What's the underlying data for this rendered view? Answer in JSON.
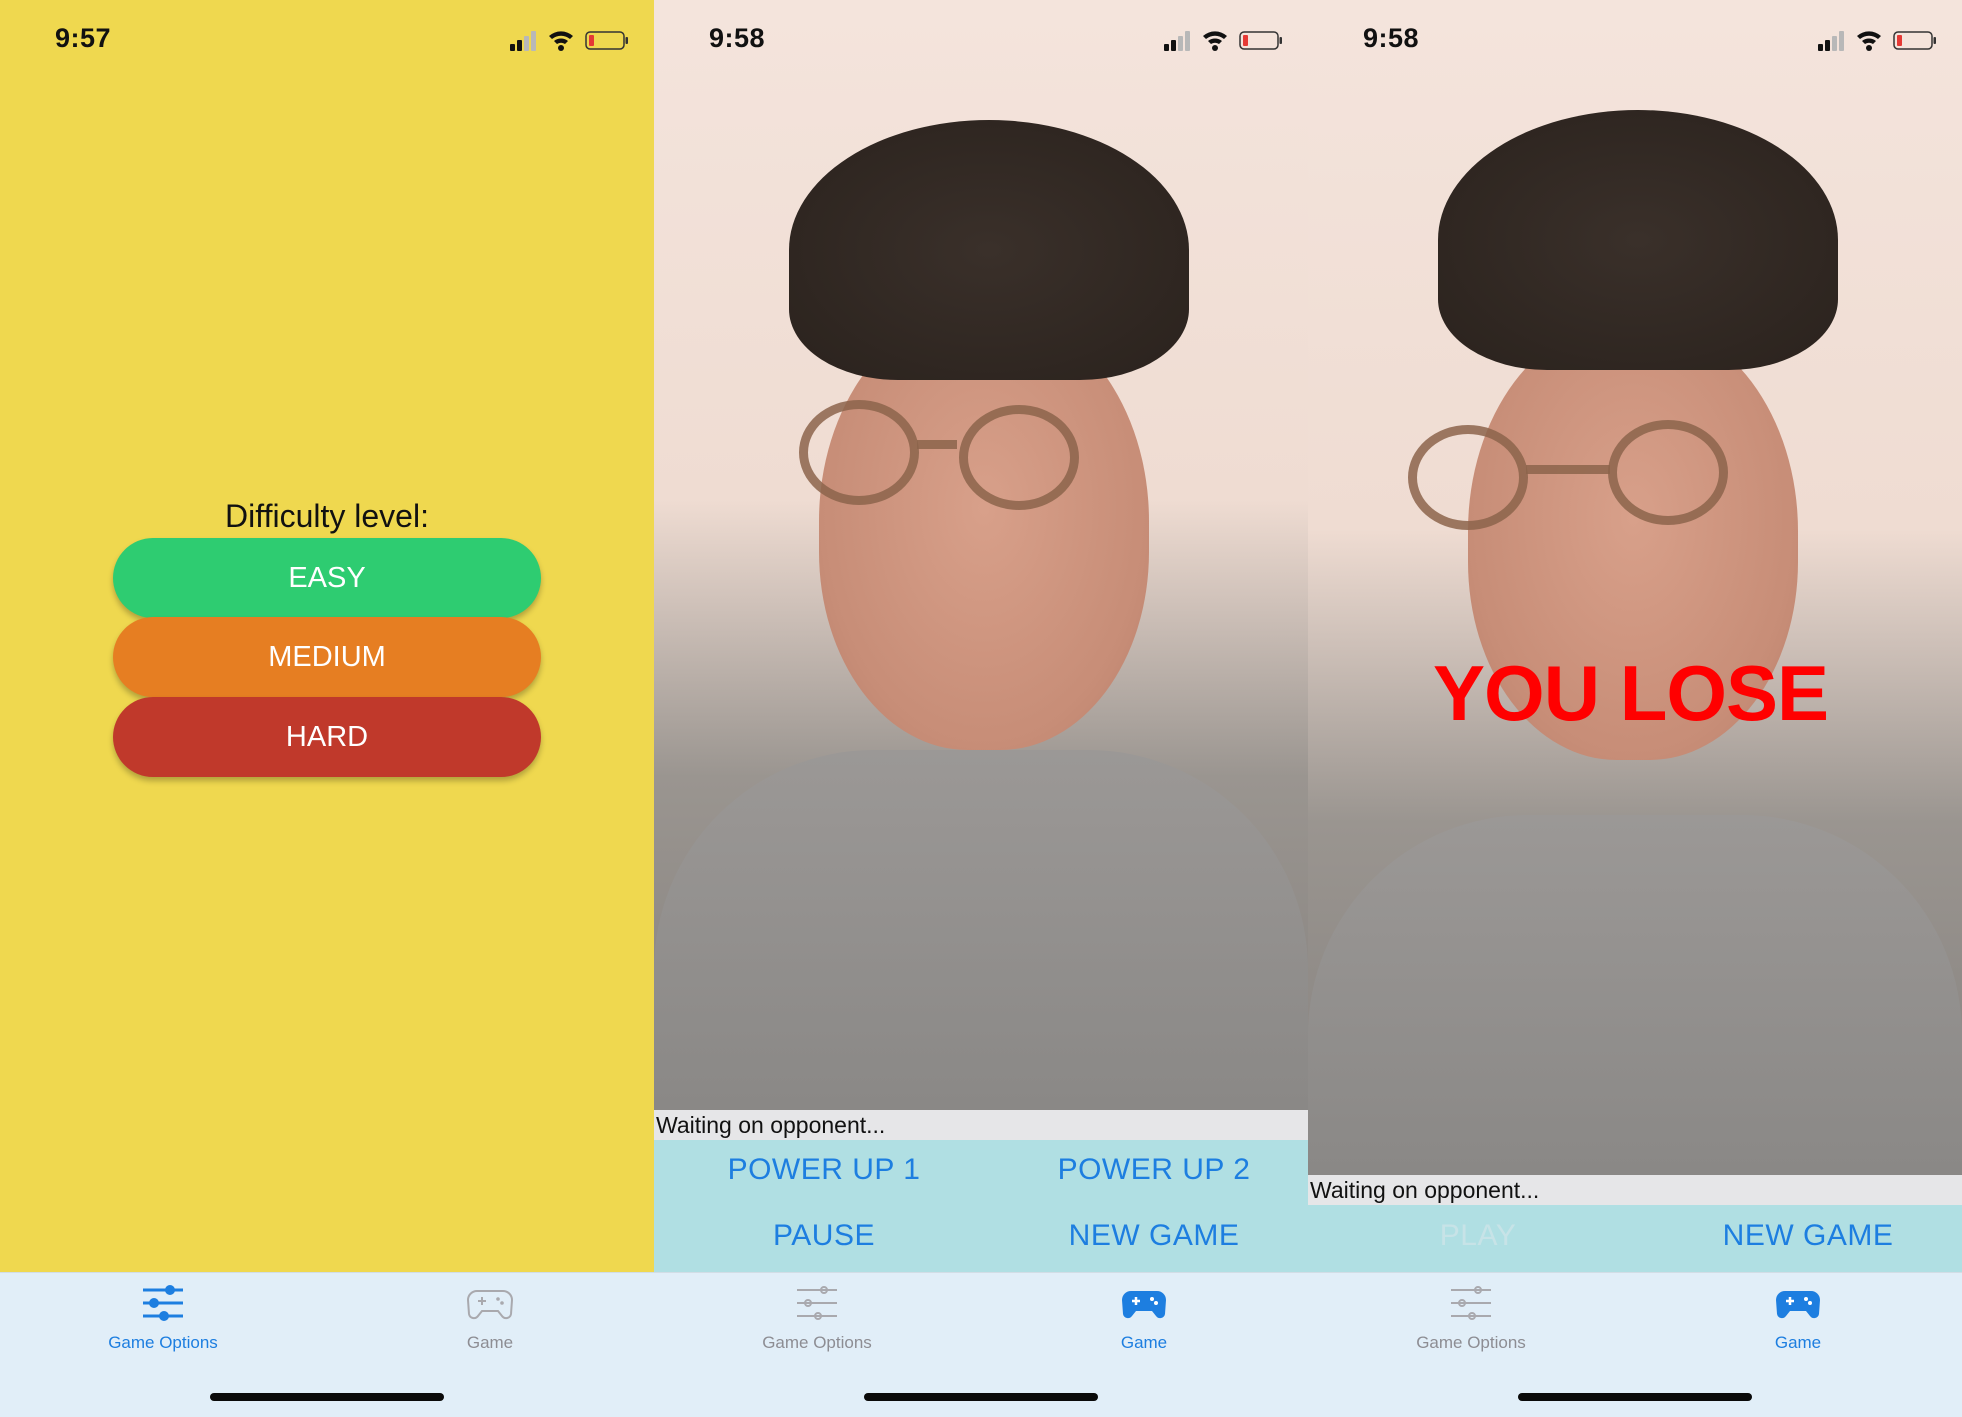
{
  "screens": [
    {
      "status_time": "9:57",
      "difficulty_label": "Difficulty level:",
      "buttons": {
        "easy": "EASY",
        "medium": "MEDIUM",
        "hard": "HARD"
      },
      "tabs": [
        {
          "label": "Game Options",
          "icon": "sliders-icon",
          "active": true
        },
        {
          "label": "Game",
          "icon": "gamepad-icon",
          "active": false
        }
      ]
    },
    {
      "status_time": "9:58",
      "status_message": "Waiting on opponent...",
      "controls": {
        "power_up_1": "POWER UP 1",
        "power_up_2": "POWER UP 2",
        "pause": "PAUSE",
        "new_game": "NEW GAME"
      },
      "tabs": [
        {
          "label": "Game Options",
          "icon": "sliders-icon",
          "active": false
        },
        {
          "label": "Game",
          "icon": "gamepad-icon",
          "active": true
        }
      ]
    },
    {
      "status_time": "9:58",
      "overlay_text": "YOU LOSE",
      "status_message": "Waiting on opponent...",
      "controls": {
        "play": "PLAY",
        "new_game": "NEW GAME"
      },
      "tabs": [
        {
          "label": "Game Options",
          "icon": "sliders-icon",
          "active": false
        },
        {
          "label": "Game",
          "icon": "gamepad-icon",
          "active": true
        }
      ]
    }
  ],
  "colors": {
    "background_yellow": "#efd84f",
    "easy": "#2ecc71",
    "medium": "#e67e22",
    "hard": "#c0392b",
    "accent_blue": "#1d7ee0",
    "controls_bg": "#b0dfe3",
    "tabbar_bg": "#e1eef8",
    "lose_red": "#ff0000",
    "battery_low": "#e53935"
  }
}
